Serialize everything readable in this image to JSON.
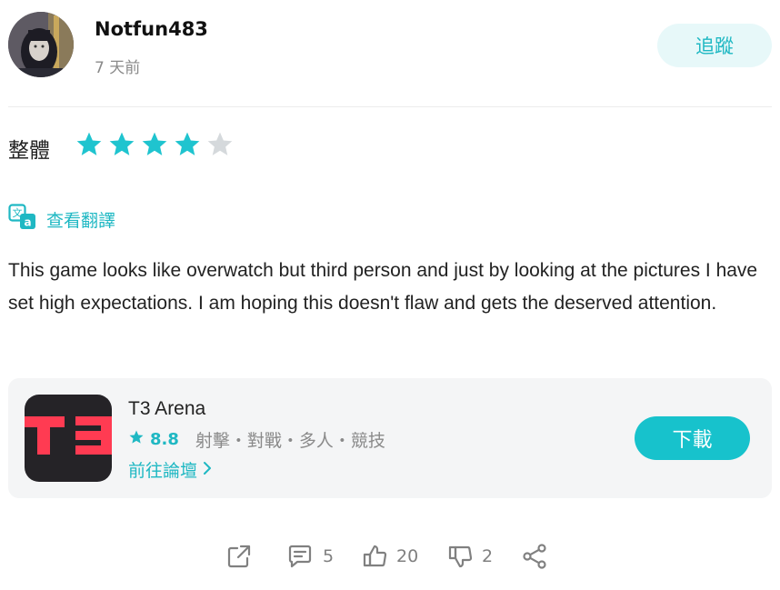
{
  "author": {
    "name": "Notfun483",
    "time": "7 天前"
  },
  "follow_label": "追蹤",
  "rating": {
    "label": "整體",
    "value": 4,
    "max": 5,
    "filled_color": "#1fc4cf",
    "empty_color": "#d5d9dc"
  },
  "translate_label": "查看翻譯",
  "review_text": "This game looks like overwatch but third person and just by looking at the pictures I have set high expectations. I am hoping this doesn't flaw and gets the deserved attention.",
  "app": {
    "name": "T3 Arena",
    "score": "8.8",
    "tags": "射擊・對戰・多人・競技",
    "forum_label": "前往論壇",
    "download_label": "下載",
    "icon_text": "T3"
  },
  "actions": {
    "comments": "5",
    "likes": "20",
    "dislikes": "2"
  },
  "colors": {
    "accent": "#1fb8c3",
    "button": "#17c2cc",
    "muted": "#8a8a8a",
    "card_bg": "#f4f5f6"
  }
}
